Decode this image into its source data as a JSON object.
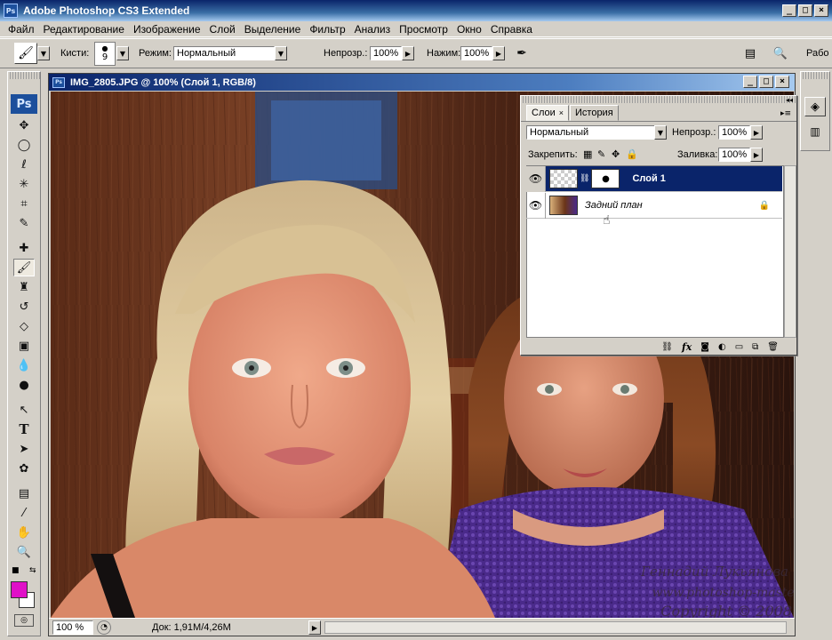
{
  "window": {
    "title": "Adobe Photoshop CS3 Extended",
    "logo": "Ps"
  },
  "menu": [
    "Файл",
    "Редактирование",
    "Изображение",
    "Слой",
    "Выделение",
    "Фильтр",
    "Анализ",
    "Просмотр",
    "Окно",
    "Справка"
  ],
  "options": {
    "brushes_label": "Кисти:",
    "brush_size": "9",
    "mode_label": "Режим:",
    "mode_value": "Нормальный",
    "opacity_label": "Непрозр.:",
    "opacity_value": "100%",
    "flow_label": "Нажим:",
    "flow_value": "100%",
    "workspace_label": "Рабо"
  },
  "toolbox": {
    "logo": "Ps",
    "foreground_color": "#e010c8",
    "background_color": "#ffffff"
  },
  "document": {
    "title": "IMG_2805.JPG @ 100% (Слой 1, RGB/8)",
    "zoom": "100 %",
    "doc_info": "Док: 1,91M/4,26M"
  },
  "watermark": {
    "line1": "Геннадий Лукьянова",
    "line2": "www.photoshop-master.ru",
    "line3": "Copyright © 2008"
  },
  "layers_panel": {
    "tabs": [
      "Слои",
      "История"
    ],
    "blend_mode": "Нормальный",
    "opacity_label": "Непрозр.:",
    "opacity_value": "100%",
    "lock_label": "Закрепить:",
    "fill_label": "Заливка:",
    "fill_value": "100%",
    "layers": [
      {
        "name": "Слой 1",
        "selected": true
      },
      {
        "name": "Задний план",
        "selected": false
      }
    ]
  }
}
